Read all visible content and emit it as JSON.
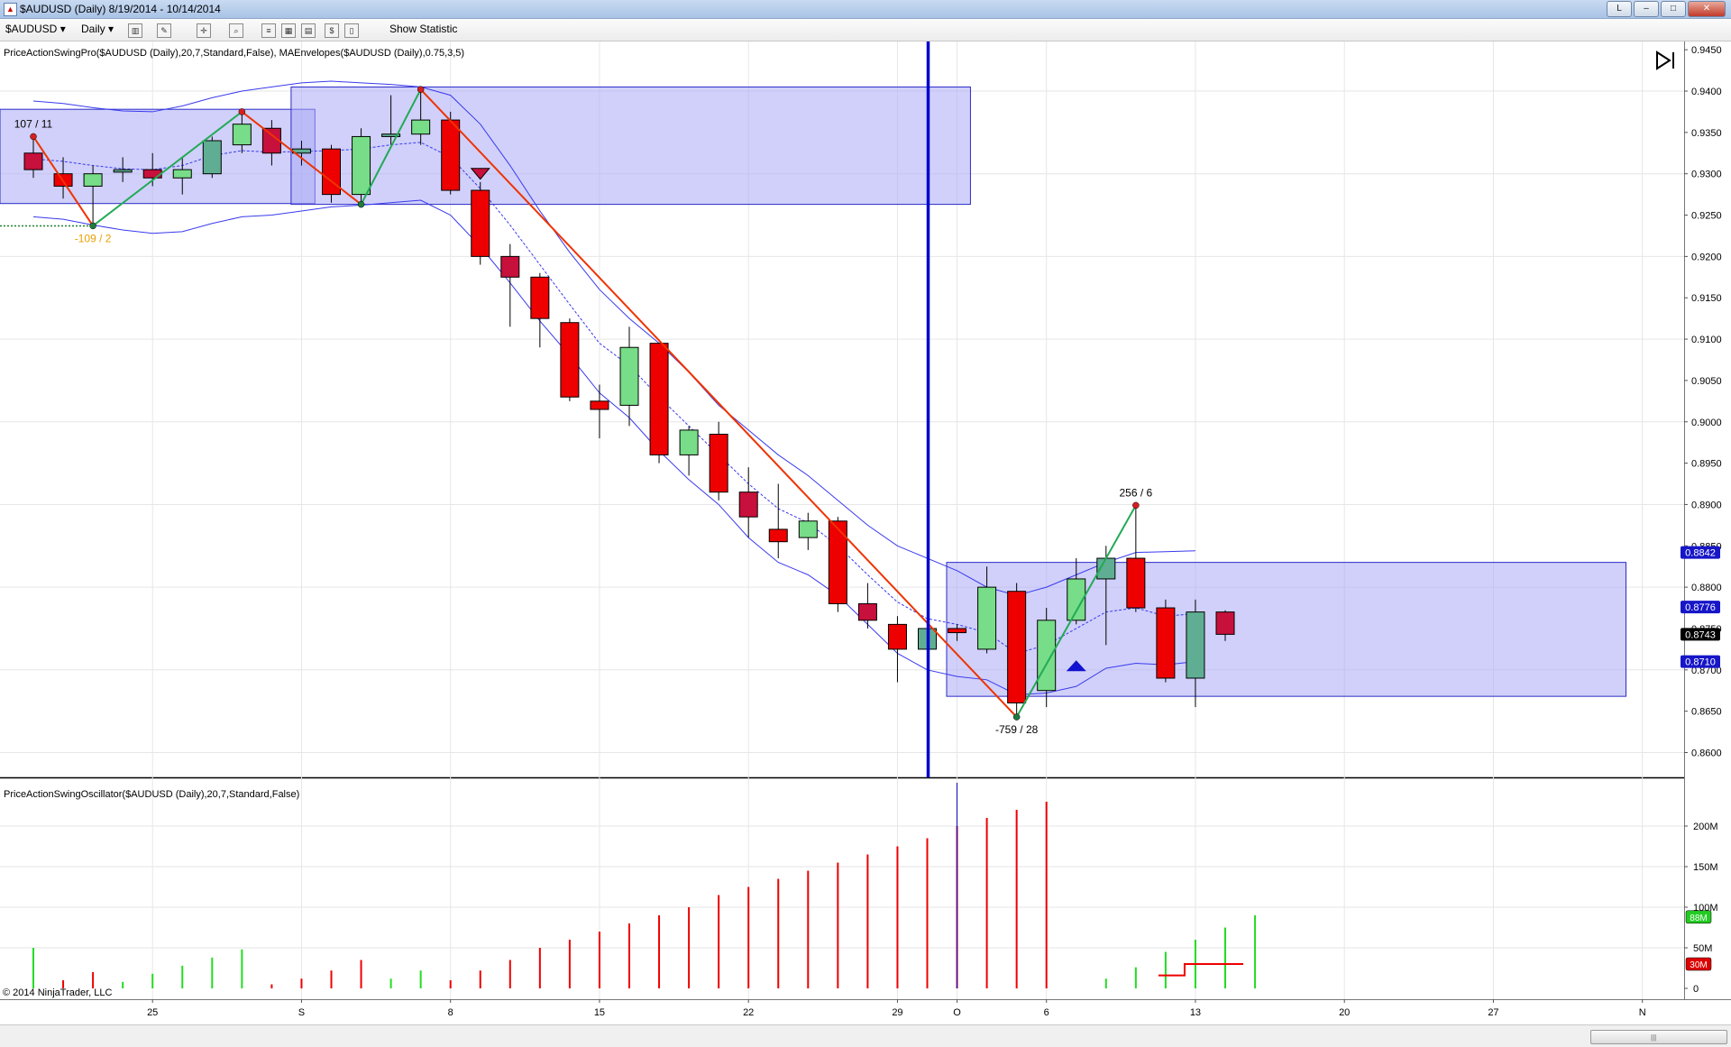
{
  "window": {
    "title": "$AUDUSD (Daily)  8/19/2014 - 10/14/2014",
    "buttons": [
      "L",
      "–",
      "□",
      "✕"
    ]
  },
  "toolbar": {
    "instrument": "$AUDUSD",
    "period": "Daily",
    "show_statistic": "Show Statistic"
  },
  "icons": [
    "window-icon",
    "chart-style-icon",
    "drawing-tool-icon",
    "crosshair-icon",
    "zoom-icon",
    "indicators-icon",
    "strategies-icon",
    "data-box-icon",
    "properties-icon"
  ],
  "copyright": "© 2014 NinjaTrader, LLC",
  "colors": {
    "bull": "#77dd88",
    "bull_alt": "#5fae93",
    "bear": "#ee0000",
    "bear_alt": "#c8103c",
    "envelope": "#3a3aee",
    "zone_fill": "#aaaaf5",
    "zone_stroke": "#2b2bc8",
    "swing_up": "#22aa55",
    "swing_down": "#ee3300",
    "vline": "#0000cc"
  },
  "chart_data": [
    {
      "type": "candlestick",
      "label": "PriceActionSwingPro($AUDUSD (Daily),20,7,Standard,False), MAEnvelopes($AUDUSD (Daily),0.75,3,5)",
      "ylim": [
        0.857,
        0.946
      ],
      "yticks": [
        "0.9450",
        "0.9400",
        "0.9350",
        "0.9300",
        "0.9250",
        "0.9200",
        "0.9150",
        "0.9100",
        "0.9050",
        "0.9000",
        "0.8950",
        "0.8900",
        "0.8850",
        "0.8800",
        "0.8750",
        "0.8700",
        "0.8650",
        "0.8600"
      ],
      "ytick_values": [
        0.945,
        0.94,
        0.935,
        0.93,
        0.925,
        0.92,
        0.915,
        0.91,
        0.905,
        0.9,
        0.895,
        0.89,
        0.885,
        0.88,
        0.875,
        0.87,
        0.865,
        0.86
      ],
      "xtick_labels": [
        {
          "label": "25",
          "date": "2014-08-25"
        },
        {
          "label": "S",
          "date": "2014-09-01"
        },
        {
          "label": "8",
          "date": "2014-09-08"
        },
        {
          "label": "15",
          "date": "2014-09-15"
        },
        {
          "label": "22",
          "date": "2014-09-22"
        },
        {
          "label": "29",
          "date": "2014-09-29"
        },
        {
          "label": "O",
          "date": "2014-10-01"
        },
        {
          "label": "6",
          "date": "2014-10-06"
        },
        {
          "label": "13",
          "date": "2014-10-13"
        },
        {
          "label": "20",
          "date": "2014-10-20"
        },
        {
          "label": "27",
          "date": "2014-10-27"
        },
        {
          "label": "N",
          "date": "2014-11-03"
        }
      ],
      "candles": [
        {
          "date": "2014-08-19",
          "open": 0.9325,
          "high": 0.9345,
          "low": 0.9295,
          "close": 0.9305
        },
        {
          "date": "2014-08-20",
          "open": 0.93,
          "high": 0.932,
          "low": 0.927,
          "close": 0.9285
        },
        {
          "date": "2014-08-21",
          "open": 0.9285,
          "high": 0.931,
          "low": 0.9235,
          "close": 0.93
        },
        {
          "date": "2014-08-22",
          "open": 0.9302,
          "high": 0.932,
          "low": 0.929,
          "close": 0.9305
        },
        {
          "date": "2014-08-25",
          "open": 0.9305,
          "high": 0.9325,
          "low": 0.9285,
          "close": 0.9295
        },
        {
          "date": "2014-08-26",
          "open": 0.9295,
          "high": 0.932,
          "low": 0.9275,
          "close": 0.9305
        },
        {
          "date": "2014-08-27",
          "open": 0.93,
          "high": 0.9345,
          "low": 0.9295,
          "close": 0.934
        },
        {
          "date": "2014-08-28",
          "open": 0.9335,
          "high": 0.9375,
          "low": 0.9325,
          "close": 0.936
        },
        {
          "date": "2014-08-29",
          "open": 0.9355,
          "high": 0.9365,
          "low": 0.931,
          "close": 0.9325
        },
        {
          "date": "2014-09-01",
          "open": 0.9325,
          "high": 0.934,
          "low": 0.931,
          "close": 0.933
        },
        {
          "date": "2014-09-02",
          "open": 0.933,
          "high": 0.9335,
          "low": 0.9265,
          "close": 0.9275
        },
        {
          "date": "2014-09-03",
          "open": 0.9275,
          "high": 0.9355,
          "low": 0.9265,
          "close": 0.9345
        },
        {
          "date": "2014-09-04",
          "open": 0.9345,
          "high": 0.9395,
          "low": 0.9335,
          "close": 0.9348
        },
        {
          "date": "2014-09-05",
          "open": 0.9348,
          "high": 0.94,
          "low": 0.9335,
          "close": 0.9365
        },
        {
          "date": "2014-09-08",
          "open": 0.9365,
          "high": 0.9375,
          "low": 0.9275,
          "close": 0.928
        },
        {
          "date": "2014-09-09",
          "open": 0.928,
          "high": 0.929,
          "low": 0.919,
          "close": 0.92
        },
        {
          "date": "2014-09-10",
          "open": 0.92,
          "high": 0.9215,
          "low": 0.9115,
          "close": 0.9175
        },
        {
          "date": "2014-09-11",
          "open": 0.9175,
          "high": 0.918,
          "low": 0.909,
          "close": 0.9125
        },
        {
          "date": "2014-09-12",
          "open": 0.912,
          "high": 0.9125,
          "low": 0.9025,
          "close": 0.903
        },
        {
          "date": "2014-09-15",
          "open": 0.9025,
          "high": 0.9045,
          "low": 0.898,
          "close": 0.9015
        },
        {
          "date": "2014-09-16",
          "open": 0.902,
          "high": 0.9115,
          "low": 0.8995,
          "close": 0.909
        },
        {
          "date": "2014-09-17",
          "open": 0.9095,
          "high": 0.9095,
          "low": 0.895,
          "close": 0.896
        },
        {
          "date": "2014-09-18",
          "open": 0.896,
          "high": 0.8995,
          "low": 0.8935,
          "close": 0.899
        },
        {
          "date": "2014-09-19",
          "open": 0.8985,
          "high": 0.9,
          "low": 0.8905,
          "close": 0.8915
        },
        {
          "date": "2014-09-22",
          "open": 0.8915,
          "high": 0.8945,
          "low": 0.886,
          "close": 0.8885
        },
        {
          "date": "2014-09-23",
          "open": 0.887,
          "high": 0.8925,
          "low": 0.8835,
          "close": 0.8855
        },
        {
          "date": "2014-09-24",
          "open": 0.886,
          "high": 0.889,
          "low": 0.8845,
          "close": 0.888
        },
        {
          "date": "2014-09-25",
          "open": 0.888,
          "high": 0.8885,
          "low": 0.877,
          "close": 0.878
        },
        {
          "date": "2014-09-26",
          "open": 0.878,
          "high": 0.8805,
          "low": 0.875,
          "close": 0.876
        },
        {
          "date": "2014-09-29",
          "open": 0.8755,
          "high": 0.8765,
          "low": 0.8685,
          "close": 0.8725
        },
        {
          "date": "2014-09-30",
          "open": 0.8725,
          "high": 0.8755,
          "low": 0.8715,
          "close": 0.875
        },
        {
          "date": "2014-10-01",
          "open": 0.875,
          "high": 0.8755,
          "low": 0.8735,
          "close": 0.8745
        },
        {
          "date": "2014-10-02",
          "open": 0.8725,
          "high": 0.8825,
          "low": 0.872,
          "close": 0.88
        },
        {
          "date": "2014-10-03",
          "open": 0.8795,
          "high": 0.8805,
          "low": 0.8645,
          "close": 0.866
        },
        {
          "date": "2014-10-06",
          "open": 0.8675,
          "high": 0.8775,
          "low": 0.8655,
          "close": 0.876
        },
        {
          "date": "2014-10-07",
          "open": 0.876,
          "high": 0.8835,
          "low": 0.8755,
          "close": 0.881
        },
        {
          "date": "2014-10-08",
          "open": 0.881,
          "high": 0.885,
          "low": 0.873,
          "close": 0.8835
        },
        {
          "date": "2014-10-09",
          "open": 0.8835,
          "high": 0.89,
          "low": 0.877,
          "close": 0.8775
        },
        {
          "date": "2014-10-10",
          "open": 0.8775,
          "high": 0.8785,
          "low": 0.8685,
          "close": 0.869
        },
        {
          "date": "2014-10-13",
          "open": 0.869,
          "high": 0.8785,
          "low": 0.8655,
          "close": 0.877
        },
        {
          "date": "2014-10-14",
          "open": 0.877,
          "high": 0.8772,
          "low": 0.8735,
          "close": 0.8743
        }
      ],
      "envelope": {
        "middle": [
          0.9318,
          0.9315,
          0.931,
          0.9306,
          0.9305,
          0.931,
          0.9322,
          0.9328,
          0.9326,
          0.9327,
          0.9328,
          0.933,
          0.9335,
          0.9338,
          0.932,
          0.9282,
          0.9238,
          0.919,
          0.9142,
          0.9095,
          0.9068,
          0.903,
          0.8995,
          0.896,
          0.8925,
          0.8895,
          0.8878,
          0.885,
          0.8815,
          0.8782,
          0.8762,
          0.8755,
          0.8745,
          0.872,
          0.873,
          0.875,
          0.877,
          0.8775,
          0.8765,
          0.8768
        ],
        "upper": [
          0.9388,
          0.9385,
          0.938,
          0.9376,
          0.9375,
          0.9382,
          0.9392,
          0.94,
          0.9405,
          0.941,
          0.9412,
          0.941,
          0.9408,
          0.9405,
          0.9395,
          0.936,
          0.931,
          0.9255,
          0.9205,
          0.916,
          0.9125,
          0.9095,
          0.906,
          0.902,
          0.899,
          0.896,
          0.8935,
          0.8905,
          0.8875,
          0.885,
          0.8835,
          0.882,
          0.88,
          0.879,
          0.88,
          0.8815,
          0.883,
          0.8842,
          0.8843,
          0.8844
        ],
        "lower": [
          0.9248,
          0.9245,
          0.9238,
          0.9232,
          0.9228,
          0.923,
          0.924,
          0.9248,
          0.925,
          0.9255,
          0.926,
          0.9262,
          0.9265,
          0.9268,
          0.925,
          0.9212,
          0.9168,
          0.9122,
          0.908,
          0.9035,
          0.9005,
          0.8965,
          0.893,
          0.89,
          0.886,
          0.883,
          0.8815,
          0.879,
          0.8755,
          0.872,
          0.87,
          0.8692,
          0.8688,
          0.867,
          0.8672,
          0.868,
          0.8702,
          0.8708,
          0.8706,
          0.871
        ]
      },
      "zones": [
        {
          "start": "2014-08-18",
          "end": "2014-09-01",
          "low": 0.9264,
          "high": 0.9378
        },
        {
          "start": "2014-09-01",
          "end": "2014-10-01",
          "low": 0.9263,
          "high": 0.9405
        },
        {
          "start": "2014-10-01",
          "end": "2014-10-31",
          "low": 0.8668,
          "high": 0.883
        }
      ],
      "swings": [
        {
          "date": "2014-08-19",
          "price": 0.9345,
          "label": "107 / 11"
        },
        {
          "date": "2014-08-21",
          "price": 0.9237,
          "label": "-109 / 2"
        },
        {
          "date": "2014-08-28",
          "price": 0.9375,
          "label": ""
        },
        {
          "date": "2014-09-03",
          "price": 0.9263,
          "label": ""
        },
        {
          "date": "2014-09-05",
          "price": 0.9402,
          "label": ""
        },
        {
          "date": "2014-10-03",
          "price": 0.8643,
          "label": "-759 / 28"
        },
        {
          "date": "2014-10-09",
          "price": 0.8899,
          "label": "256 / 6"
        }
      ],
      "vertical_line_date": "2014-09-30",
      "price_markers": [
        {
          "label": "0.8842",
          "value": 0.8842,
          "style": "blue"
        },
        {
          "label": "0.8776",
          "value": 0.8776,
          "style": "blue"
        },
        {
          "label": "0.8743",
          "value": 0.8743,
          "style": "black"
        },
        {
          "label": "0.8710",
          "value": 0.871,
          "style": "blue"
        }
      ],
      "signals": [
        {
          "date": "2014-09-09",
          "price": 0.93,
          "type": "down-triangle"
        },
        {
          "date": "2014-10-07",
          "price": 0.8705,
          "type": "up-triangle"
        }
      ]
    },
    {
      "type": "bar",
      "label": "PriceActionSwingOscillator($AUDUSD (Daily),20,7,Standard,False)",
      "ylim": [
        0,
        240
      ],
      "yticks": [
        "200M",
        "150M",
        "100M",
        "50M",
        "0"
      ],
      "ytick_values": [
        200,
        150,
        100,
        50,
        0
      ],
      "values": [
        50,
        10,
        20,
        8,
        18,
        28,
        38,
        48,
        5,
        12,
        22,
        35,
        12,
        22,
        10,
        22,
        35,
        50,
        60,
        70,
        80,
        90,
        100,
        115,
        125,
        135,
        145,
        155,
        165,
        175,
        185,
        200,
        210,
        220,
        230,
        0,
        12,
        26,
        45,
        60,
        75,
        90
      ],
      "colors": [
        "g",
        "r",
        "r",
        "g",
        "g",
        "g",
        "g",
        "g",
        "r",
        "r",
        "r",
        "r",
        "g",
        "g",
        "r",
        "r",
        "r",
        "r",
        "r",
        "r",
        "r",
        "r",
        "r",
        "r",
        "r",
        "r",
        "r",
        "r",
        "r",
        "r",
        "r",
        "r",
        "r",
        "r",
        "r",
        "r",
        "g",
        "g",
        "g",
        "g",
        "g",
        "g"
      ],
      "markers": [
        {
          "label": "88M",
          "value": 88,
          "style": "green"
        },
        {
          "label": "30M",
          "value": 30,
          "style": "red"
        }
      ]
    }
  ]
}
